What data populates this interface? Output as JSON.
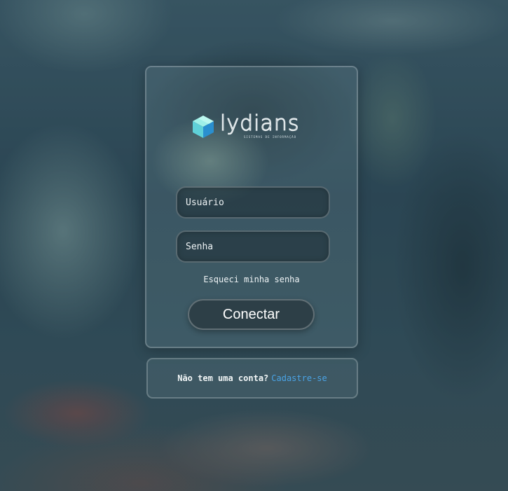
{
  "logo": {
    "brand": "lydians",
    "tagline": "SISTEMAS DE INFORMAÇÃO"
  },
  "login": {
    "username_placeholder": "Usuário",
    "password_placeholder": "Senha",
    "forgot_password": "Esqueci minha senha",
    "submit_label": "Conectar"
  },
  "signup": {
    "prompt": "Não tem uma conta?",
    "link": "Cadastre-se"
  },
  "colors": {
    "link": "#4aa3e6",
    "logo_cube_light": "#7fe3e0",
    "logo_cube_dark": "#2a9bd6"
  },
  "icons": {
    "logo": "cube-logo-icon"
  }
}
